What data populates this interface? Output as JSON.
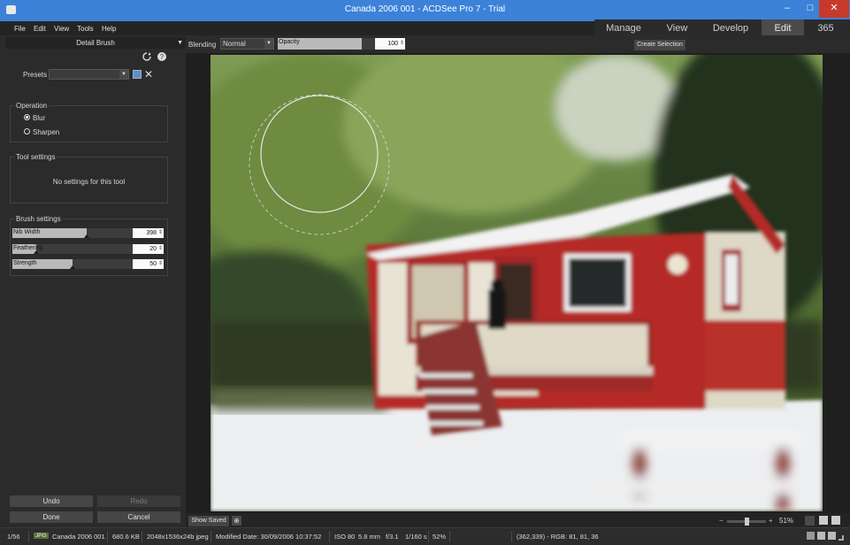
{
  "window": {
    "title": "Canada 2006 001 - ACDSee Pro 7 - Trial",
    "min": "–",
    "max": "□",
    "close": "✕"
  },
  "menu": [
    "File",
    "Edit",
    "View",
    "Tools",
    "Help"
  ],
  "mode_tabs": [
    "Manage",
    "View",
    "Develop",
    "Edit",
    "365"
  ],
  "active_mode": "Edit",
  "toolbar": {
    "blending_label": "Blending",
    "blending_value": "Normal",
    "opacity_label": "Opacity",
    "opacity_value": "100",
    "opacity_fraction": 0.86,
    "create_selection": "Create Selection"
  },
  "panel": {
    "title": "Detail Brush",
    "presets_label": "Presets",
    "presets_value": "",
    "operation_title": "Operation",
    "operation_options": [
      "Blur",
      "Sharpen"
    ],
    "operation_selected": "Blur",
    "tool_settings_title": "Tool settings",
    "tool_settings_msg": "No settings for this tool",
    "brush_settings_title": "Brush settings",
    "sliders": [
      {
        "label": "Nib Width",
        "value": "398",
        "fraction": 0.62
      },
      {
        "label": "Feathering",
        "value": "20",
        "fraction": 0.2
      },
      {
        "label": "Strength",
        "value": "50",
        "fraction": 0.5
      }
    ],
    "undo": "Undo",
    "redo": "Redo",
    "done": "Done",
    "cancel": "Cancel"
  },
  "bottom": {
    "show_saved": "Show Saved",
    "zoom": "51%",
    "zoom_minus": "−",
    "zoom_plus": "+"
  },
  "status": {
    "index": "1/56",
    "format": "JPG",
    "filename": "Canada 2006 001",
    "filesize": "680.6 KB",
    "dimensions": "2048x1536x24b jpeg",
    "modified": "Modified Date: 30/09/2006 10:37:52",
    "iso": "ISO 80",
    "focal": "5.8 mm",
    "aperture": "f/3.1",
    "shutter": "1/160 s",
    "zoom": "52%",
    "pixel_info": "(362,339) - RGB: 81, 81, 36"
  }
}
